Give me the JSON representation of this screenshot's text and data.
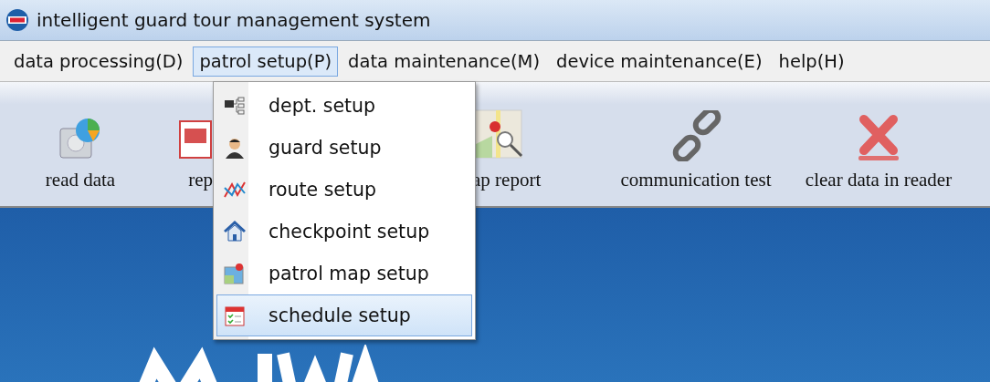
{
  "window": {
    "title": "intelligent guard tour management system"
  },
  "menu_bar": [
    {
      "label": "data processing(D)",
      "selected": false
    },
    {
      "label": "patrol setup(P)",
      "selected": true
    },
    {
      "label": "data maintenance(M)",
      "selected": false
    },
    {
      "label": "device maintenance(E)",
      "selected": false
    },
    {
      "label": "help(H)",
      "selected": false
    }
  ],
  "toolbar": [
    {
      "kind": "disk",
      "label": "read data"
    },
    {
      "kind": "report",
      "label": "rep"
    },
    {
      "kind": "gap"
    },
    {
      "kind": "map",
      "label": "ap report"
    },
    {
      "kind": "link",
      "label": "communication test"
    },
    {
      "kind": "clear",
      "label": "clear data in reader"
    }
  ],
  "dropdown": [
    {
      "kind": "dept",
      "label": "dept. setup",
      "selected": false
    },
    {
      "kind": "guard",
      "label": "guard setup",
      "selected": false
    },
    {
      "kind": "route",
      "label": "route setup",
      "selected": false
    },
    {
      "kind": "house",
      "label": "checkpoint setup",
      "selected": false
    },
    {
      "kind": "map",
      "label": "patrol map setup",
      "selected": false
    },
    {
      "kind": "calendar",
      "label": "schedule setup",
      "selected": true
    }
  ]
}
